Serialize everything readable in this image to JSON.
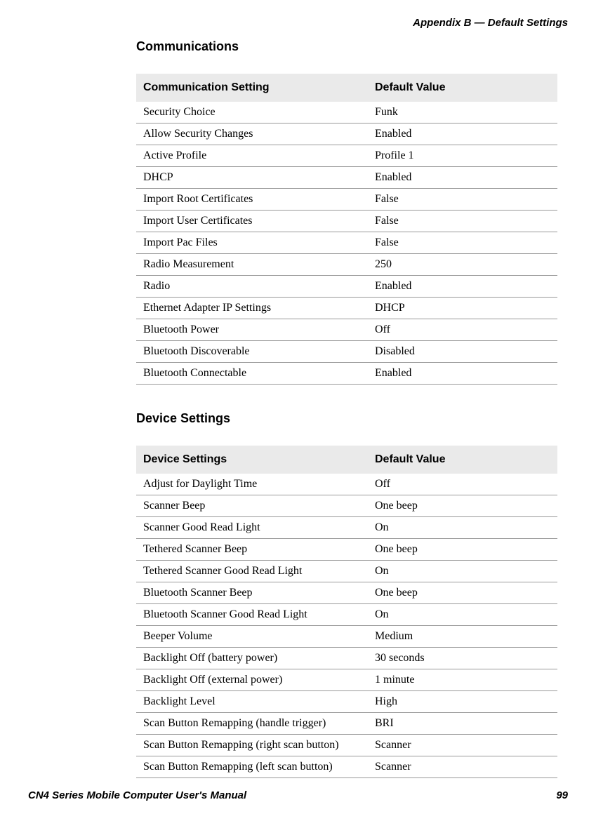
{
  "appendix_header": "Appendix B — Default Settings",
  "footer": {
    "manual_title": "CN4 Series Mobile Computer User's Manual",
    "page_number": "99"
  },
  "sections": [
    {
      "heading": "Communications",
      "col1": "Communication Setting",
      "col2": "Default Value",
      "rows": [
        {
          "setting": "Security Choice",
          "value": "Funk"
        },
        {
          "setting": "Allow Security Changes",
          "value": "Enabled"
        },
        {
          "setting": "Active Profile",
          "value": "Profile 1"
        },
        {
          "setting": "DHCP",
          "value": "Enabled"
        },
        {
          "setting": "Import Root Certificates",
          "value": "False"
        },
        {
          "setting": "Import User Certificates",
          "value": "False"
        },
        {
          "setting": "Import Pac Files",
          "value": "False"
        },
        {
          "setting": "Radio Measurement",
          "value": "250"
        },
        {
          "setting": "Radio",
          "value": "Enabled"
        },
        {
          "setting": "Ethernet Adapter IP Settings",
          "value": "DHCP"
        },
        {
          "setting": "Bluetooth Power",
          "value": "Off"
        },
        {
          "setting": "Bluetooth Discoverable",
          "value": "Disabled"
        },
        {
          "setting": "Bluetooth Connectable",
          "value": "Enabled"
        }
      ]
    },
    {
      "heading": "Device Settings",
      "col1": "Device Settings",
      "col2": "Default Value",
      "rows": [
        {
          "setting": "Adjust for Daylight Time",
          "value": "Off"
        },
        {
          "setting": "Scanner Beep",
          "value": "One beep"
        },
        {
          "setting": "Scanner Good Read Light",
          "value": "On"
        },
        {
          "setting": "Tethered Scanner Beep",
          "value": "One beep"
        },
        {
          "setting": "Tethered Scanner Good Read Light",
          "value": "On"
        },
        {
          "setting": "Bluetooth Scanner Beep",
          "value": "One beep"
        },
        {
          "setting": "Bluetooth Scanner Good Read Light",
          "value": "On"
        },
        {
          "setting": "Beeper Volume",
          "value": "Medium"
        },
        {
          "setting": "Backlight Off (battery power)",
          "value": "30 seconds"
        },
        {
          "setting": "Backlight Off (external power)",
          "value": "1 minute"
        },
        {
          "setting": "Backlight Level",
          "value": "High"
        },
        {
          "setting": "Scan Button Remapping (handle trigger)",
          "value": "BRI"
        },
        {
          "setting": "Scan Button Remapping (right scan button)",
          "value": "Scanner"
        },
        {
          "setting": "Scan Button Remapping (left scan button)",
          "value": "Scanner"
        }
      ]
    }
  ]
}
